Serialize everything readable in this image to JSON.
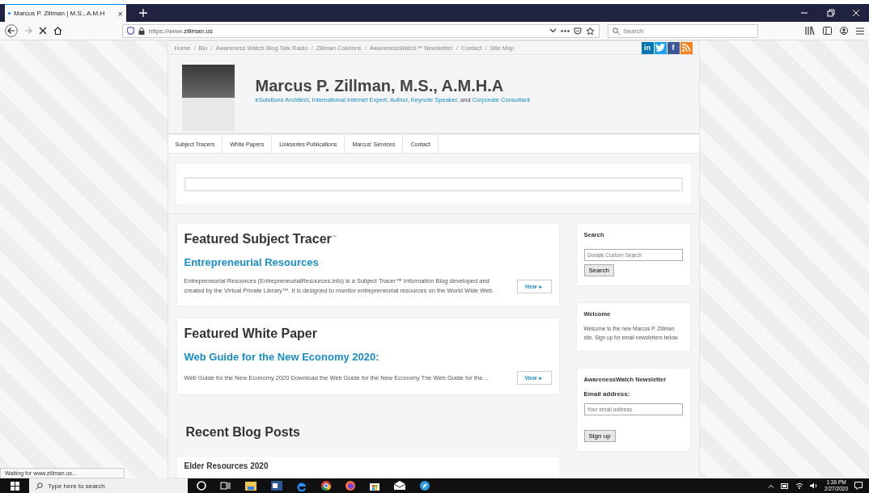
{
  "browser": {
    "tab": {
      "title": "Marcus P. Zillman | M.S., A.M.H",
      "close": "×"
    },
    "url_prefix": "https://www.",
    "url_domain": "zillman.us",
    "search_placeholder": "Search",
    "status_text": "Waiting for www.zillman.us..."
  },
  "site": {
    "breadcrumbs": [
      {
        "label": "Home"
      },
      {
        "sep": "/",
        "label": "Bio"
      },
      {
        "sep": "/",
        "label": "Awareness Watch Blog Talk Radio"
      },
      {
        "sep": "/",
        "label": "Zillman Columns"
      },
      {
        "sep": "/",
        "label": "AwarenessWatch™ Newsletter"
      },
      {
        "sep": "/",
        "label": "Contact"
      },
      {
        "sep": "/",
        "label": "Site Map"
      }
    ],
    "social": [
      {
        "kind": "linkedin",
        "label": "in",
        "color": "#0077b5"
      },
      {
        "kind": "twitter",
        "color": "#1da1f2"
      },
      {
        "kind": "facebook",
        "label": "f",
        "color": "#3b5998"
      },
      {
        "kind": "rss",
        "color": "#f7821b"
      }
    ],
    "title": "Marcus P. Zillman, M.S., A.M.H.A",
    "tagline": [
      {
        "link": "eSolutions Architect"
      },
      {
        "text": ", "
      },
      {
        "link": "International Internet Expert"
      },
      {
        "text": ", "
      },
      {
        "link": "Author"
      },
      {
        "text": ", "
      },
      {
        "link": "Keynote Speaker"
      },
      {
        "text": ", and "
      },
      {
        "link": "Corporate Consultant"
      }
    ],
    "nav": [
      "Subject Tracers",
      "White Papers",
      "Linkseries Publications",
      "Marcus' Services",
      "Contact"
    ],
    "featured": [
      {
        "heading": "Featured Subject Tracer$^{™}$",
        "title": "Entrepreneurial Resources",
        "text": "Entrepreneurial Resources (EntrepreneurialResources.info) is a Subject Tracer™ Information Blog developed and created by the Virtual Private Library™. It is designed to monitor entrepreneurial resources on the World Wide Web.",
        "button": "View ►"
      },
      {
        "heading": "Featured White Paper",
        "title": "Web Guide for the New Economy 2020:",
        "text": "Web Guide for the New Economy 2020 Download the Web Guide for the New Economy The Web Guide for the…",
        "button": "View ►"
      }
    ],
    "blog": {
      "heading": "Recent Blog Posts",
      "post_title": "Elder Resources 2020"
    },
    "sidebar": [
      {
        "kind": "search",
        "title": "Search",
        "placeholder": "Google Custom Search",
        "button": "Search"
      },
      {
        "kind": "text",
        "title": "Welcome",
        "text": "Welcome to the new Marcus P. Zillman site. Sign up for email newsletters below."
      },
      {
        "kind": "newsletter",
        "title": "AwarenessWatch Newsletter",
        "label": "Email address:",
        "placeholder": "Your email address",
        "button": "Sign up"
      }
    ]
  },
  "taskbar": {
    "search_placeholder": "Type here to search",
    "apps": [
      {
        "kind": "cortana"
      },
      {
        "kind": "task-view"
      },
      {
        "kind": "file-explorer"
      },
      {
        "kind": "word"
      },
      {
        "kind": "edge"
      },
      {
        "kind": "chrome"
      },
      {
        "kind": "firefox"
      },
      {
        "kind": "store"
      },
      {
        "kind": "mail"
      },
      {
        "kind": "safari"
      }
    ],
    "time": "1:36 PM",
    "date": "2/27/2020"
  }
}
